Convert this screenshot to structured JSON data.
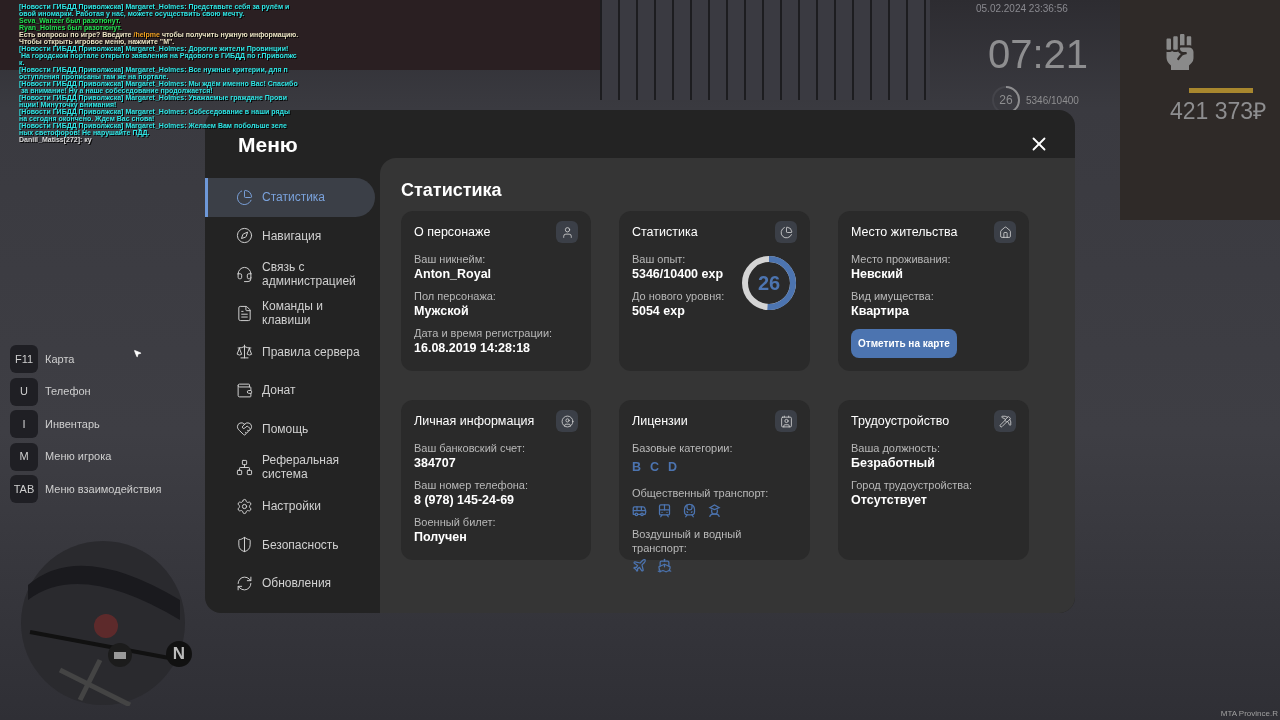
{
  "chat": [
    {
      "segments": [
        {
          "kind": "news",
          "text": "[Новости ГИБДД Приволжска] Margaret_Holmes: Представьте себя за рулём и"
        }
      ]
    },
    {
      "segments": [
        {
          "kind": "news",
          "text": "овой иномарки. Работая у нас, можете осуществить свою мечту."
        }
      ]
    },
    {
      "segments": [
        {
          "kind": "status",
          "text": "Seva_Wanzer был разотюнут."
        }
      ]
    },
    {
      "segments": [
        {
          "kind": "status",
          "text": "Ryan_Holmes был разотюнут."
        }
      ]
    },
    {
      "segments": [
        {
          "kind": "info",
          "text": "Есть вопросы по игре? Введите"
        },
        {
          "kind": "command",
          "text": "/helpme"
        },
        {
          "kind": "info",
          "text": "чтобы получить нужную информацию."
        }
      ]
    },
    {
      "segments": [
        {
          "kind": "info",
          "text": "Чтобы открыть игровое меню, нажмите \"M\"."
        }
      ]
    },
    {
      "segments": [
        {
          "kind": "news",
          "text": "[Новости ГИБДД Приволжска] Margaret_Holmes: Дорогие жители Провинции!"
        }
      ]
    },
    {
      "segments": [
        {
          "kind": "news",
          "text": " На городском портале открыто заявления на Рядового в ГИБДД по г.Приволжс"
        }
      ]
    },
    {
      "segments": [
        {
          "kind": "news",
          "text": "к."
        }
      ]
    },
    {
      "segments": [
        {
          "kind": "news",
          "text": "[Новости ГИБДД Приволжска] Margaret_Holmes: Все нужные критерии, для п"
        }
      ]
    },
    {
      "segments": [
        {
          "kind": "news",
          "text": "оступления прописаны там же на портале."
        }
      ]
    },
    {
      "segments": [
        {
          "kind": "news",
          "text": "[Новости ГИБДД Приволжска] Margaret_Holmes: Мы ждём именно Вас! Спасибо"
        }
      ]
    },
    {
      "segments": [
        {
          "kind": "news",
          "text": " за внимание! Ну а наше собеседование продолжается!"
        }
      ]
    },
    {
      "segments": [
        {
          "kind": "news",
          "text": "[Новости ГИБДД Приволжска] Margaret_Holmes: Уважаемые граждане Прови"
        }
      ]
    },
    {
      "segments": [
        {
          "kind": "news",
          "text": "нции! Минуточку внимания!"
        }
      ]
    },
    {
      "segments": [
        {
          "kind": "news",
          "text": "[Новости ГИБДД Приволжска] Margaret_Holmes: Собеседование в наши ряды"
        }
      ]
    },
    {
      "segments": [
        {
          "kind": "news",
          "text": "на сегодня окончено. Ждем Вас снова!"
        }
      ]
    },
    {
      "segments": [
        {
          "kind": "news",
          "text": "[Новости ГИБДД Приволжска] Margaret_Holmes: Желаем Вам побольше зеле"
        }
      ]
    },
    {
      "segments": [
        {
          "kind": "news",
          "text": "ных светофоров! Не нарушайте ПДД."
        }
      ]
    },
    {
      "segments": [
        {
          "kind": "message",
          "text": "Daniil_Matiss[272]: ку"
        }
      ]
    }
  ],
  "hud": {
    "date": "05.02.2024 23:36:56",
    "time": "07:21",
    "player_level": "26",
    "exp": "5346/10400",
    "exp_ring": {
      "level": 0.51
    },
    "status_bar": {
      "level": 1
    },
    "money": "421 373₽"
  },
  "menu": {
    "title": "Меню",
    "items": [
      {
        "label": "Статистика",
        "selected": true
      },
      {
        "label": "Навигация",
        "selected": false
      },
      {
        "label": "Связь с администрацией",
        "selected": false
      },
      {
        "label": "Команды и клавиши",
        "selected": false
      },
      {
        "label": "Правила сервера",
        "selected": false
      },
      {
        "label": "Донат",
        "selected": false
      },
      {
        "label": "Помощь",
        "selected": false
      },
      {
        "label": "Реферальная система",
        "selected": false
      },
      {
        "label": "Настройки",
        "selected": false
      },
      {
        "label": "Безопасность",
        "selected": false
      },
      {
        "label": "Обновления",
        "selected": false
      }
    ],
    "content": {
      "title": "Статистика",
      "cards": [
        {
          "kind": "info",
          "title": "О персонаже",
          "fields": [
            {
              "label": "Ваш никнейм:",
              "value": "Anton_Royal"
            },
            {
              "label": "Пол персонажа:",
              "value": "Мужской"
            },
            {
              "label": "Дата и время регистрации:",
              "value": "16.08.2019 14:28:18"
            }
          ]
        },
        {
          "kind": "stats",
          "title": "Статистика",
          "fields": [
            {
              "label": "Ваш опыт:",
              "value": "5346/10400 exp"
            },
            {
              "label": "До нового уровня:",
              "value": "5054 exp"
            }
          ],
          "ring": {
            "value": "26",
            "level": 0.51
          }
        },
        {
          "kind": "info",
          "title": "Место жительства",
          "fields": [
            {
              "label": "Место проживания:",
              "value": "Невский"
            },
            {
              "label": "Вид имущества:",
              "value": "Квартира"
            }
          ],
          "button": "Отметить на карте"
        },
        {
          "kind": "info",
          "title": "Личная информация",
          "fields": [
            {
              "label": "Ваш банковский счет:",
              "value": "384707"
            },
            {
              "label": "Ваш номер телефона:",
              "value": "8 (978) 145-24-69"
            },
            {
              "label": "Военный билет:",
              "value": "Получен"
            }
          ]
        },
        {
          "kind": "licenses",
          "title": "Лицензии",
          "sections": [
            {
              "kind": "letters",
              "label": "Базовые категории:",
              "items": [
                "B",
                "C",
                "D"
              ]
            },
            {
              "kind": "ground",
              "label": "Общественный транспорт:"
            },
            {
              "kind": "air_water",
              "label": "Воздушный и водный транспорт:"
            }
          ]
        },
        {
          "kind": "info",
          "title": "Трудоустройство",
          "fields": [
            {
              "label": "Ваша должность:",
              "value": "Безработный"
            },
            {
              "label": "Город трудоустройства:",
              "value": "Отсутствует"
            }
          ]
        }
      ]
    }
  },
  "hotkeys": [
    {
      "key": "F11",
      "label": "Карта"
    },
    {
      "key": "U",
      "label": "Телефон"
    },
    {
      "key": "I",
      "label": "Инвентарь"
    },
    {
      "key": "M",
      "label": "Меню игрока"
    },
    {
      "key": "TAB",
      "label": "Меню взаимодействия"
    }
  ],
  "minimap": {
    "compass": "N"
  },
  "footer": "MTA Province.R"
}
